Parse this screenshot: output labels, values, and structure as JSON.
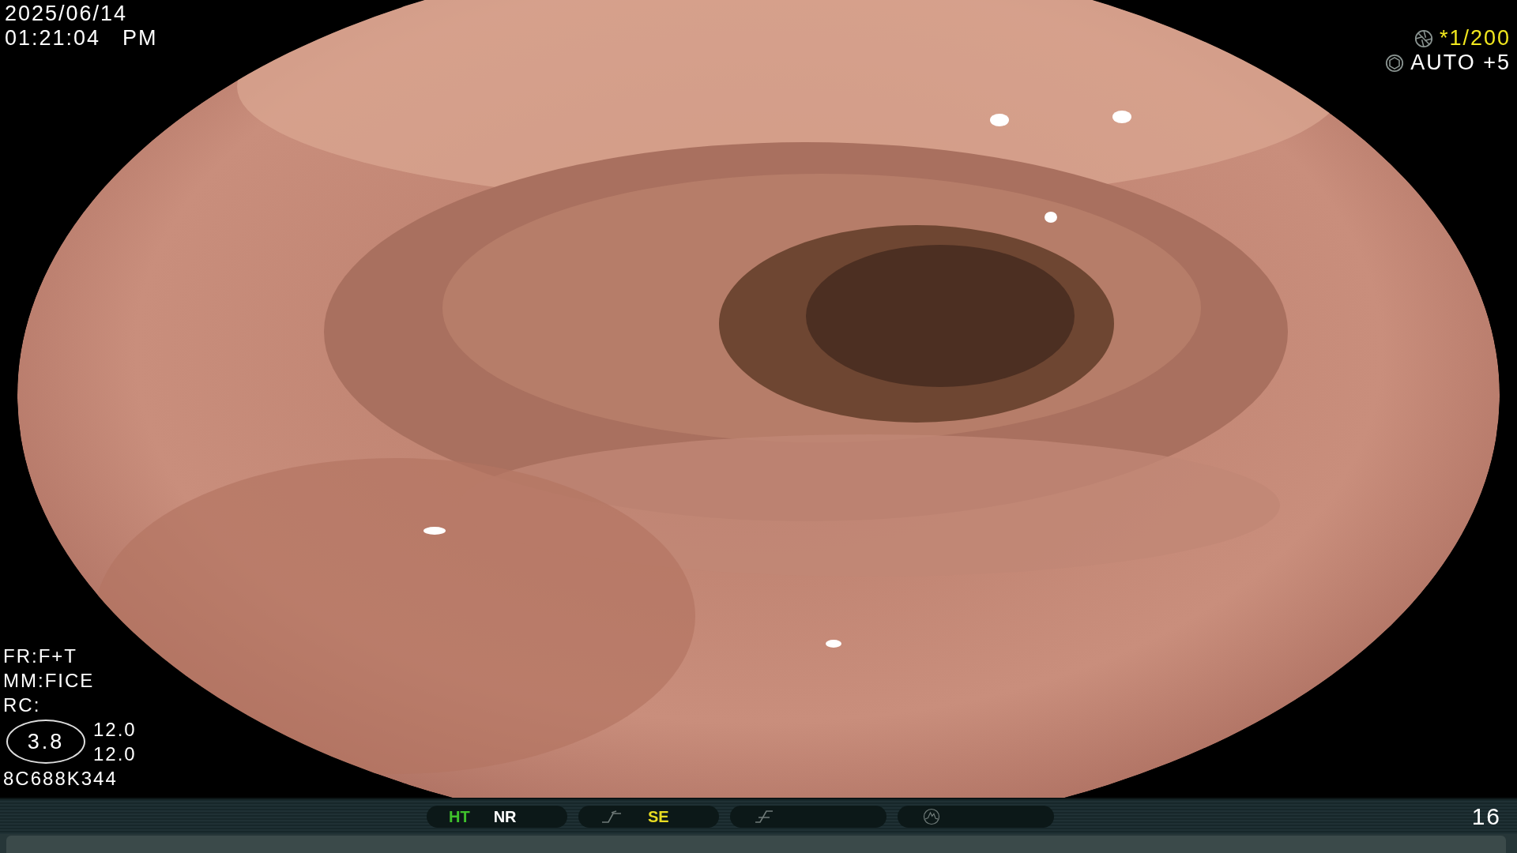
{
  "datetime": {
    "date": "2025/06/14",
    "time": "01:21:04",
    "meridiem": "PM"
  },
  "exposure": [
    {
      "kind": "shutter",
      "text": "*1/200",
      "color": "#f2e81e"
    },
    {
      "kind": "iris",
      "text": "AUTO +5",
      "color": "#ffffff"
    }
  ],
  "settings": [
    "FR:F+T",
    "MM:FICE",
    "RC:"
  ],
  "zoom": {
    "badge": "3.8",
    "values": [
      "12.0",
      "12.0"
    ]
  },
  "serial": "8C688K344",
  "footer": {
    "groups": [
      {
        "kind": "none",
        "items": [
          {
            "text": "HT",
            "color": "#3fc12c"
          },
          {
            "text": "NR",
            "color": "#ffffff"
          }
        ]
      },
      {
        "kind": "curve",
        "items": [
          {
            "text": "SE",
            "color": "#e8dc22"
          }
        ]
      },
      {
        "kind": "slash"
      },
      {
        "kind": "mountain"
      }
    ],
    "page": "16"
  }
}
